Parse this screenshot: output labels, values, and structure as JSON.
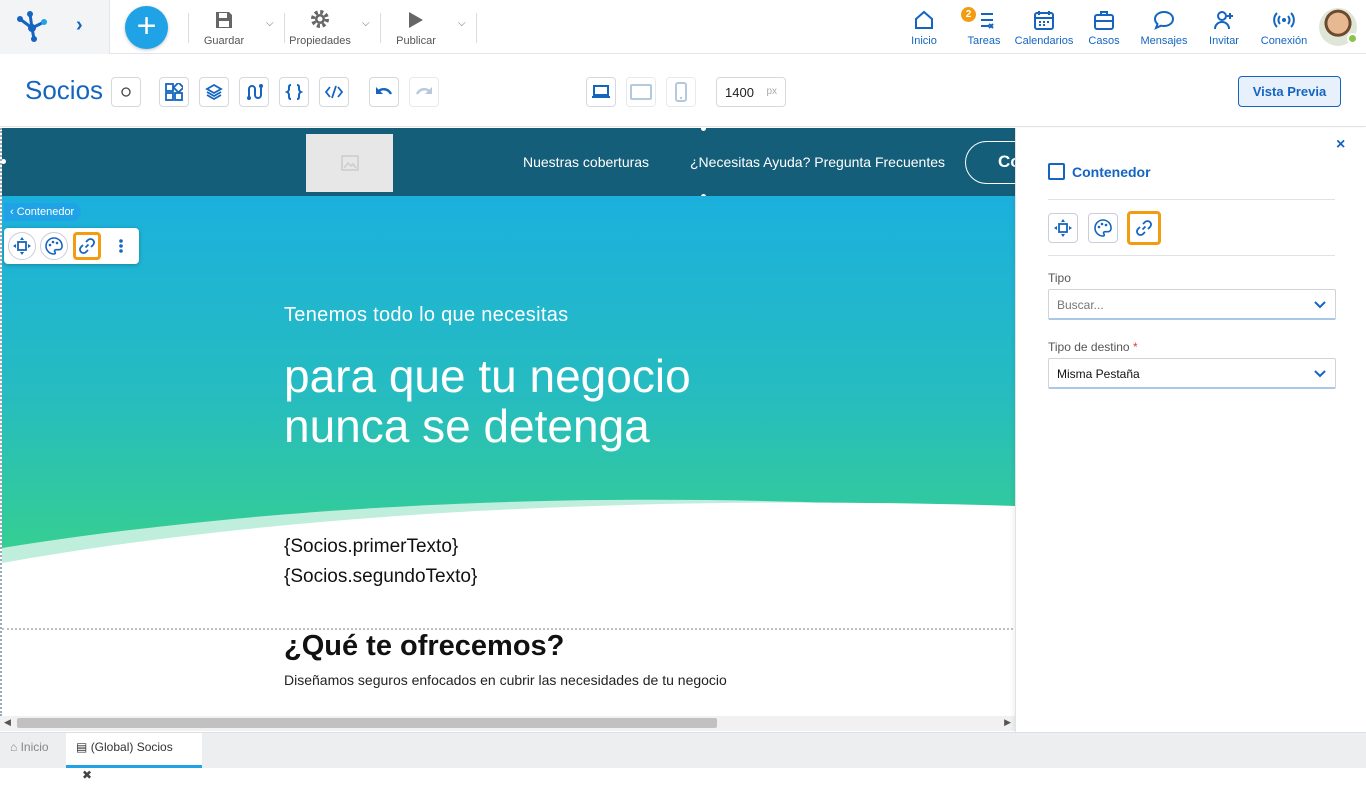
{
  "topbar": {
    "tools": [
      {
        "label": "Guardar",
        "icon": "save-icon"
      },
      {
        "label": "Propiedades",
        "icon": "gear-icon"
      },
      {
        "label": "Publicar",
        "icon": "play-icon"
      }
    ],
    "nav": [
      {
        "label": "Inicio",
        "icon": "home-icon"
      },
      {
        "label": "Tareas",
        "icon": "tasks-icon",
        "badge": "2"
      },
      {
        "label": "Calendarios",
        "icon": "calendar-icon"
      },
      {
        "label": "Casos",
        "icon": "briefcase-icon"
      },
      {
        "label": "Mensajes",
        "icon": "chat-icon"
      },
      {
        "label": "Invitar",
        "icon": "add-user-icon"
      },
      {
        "label": "Conexión",
        "icon": "signal-icon"
      }
    ]
  },
  "editor": {
    "title": "Socios",
    "width_value": "1400",
    "width_unit": "px",
    "preview_label": "Vista Previa"
  },
  "site": {
    "nav": [
      "Nuestras coberturas",
      "¿Necesitas Ayuda? Pregunta Frecuentes"
    ],
    "button_partial": "Co",
    "hero_sub": "Tenemos todo lo que necesitas",
    "hero_title_line1": "para que tu negocio",
    "hero_title_line2": "nunca se detenga",
    "text1": "{Socios.primerTexto}",
    "text2": "{Socios.segundoTexto}",
    "section_title": "¿Qué te ofrecemos?",
    "section_desc": "Diseñamos seguros enfocados en cubrir las necesidades de tu negocio"
  },
  "context": {
    "tag_label": "Contenedor"
  },
  "panel": {
    "close": "×",
    "title": "Contenedor",
    "fields": [
      {
        "label": "Tipo",
        "value": "Buscar...",
        "placeholder": true
      },
      {
        "label": "Tipo de destino",
        "required": "*",
        "value": "Misma Pestaña"
      }
    ]
  },
  "bottom_tabs": [
    {
      "label": "Inicio"
    },
    {
      "label": "(Global) Socios",
      "close": "✖"
    }
  ],
  "colors": {
    "primary": "#1565c0",
    "accent": "#1fa3e6",
    "highlight": "#f39c12",
    "header": "#155e79"
  }
}
